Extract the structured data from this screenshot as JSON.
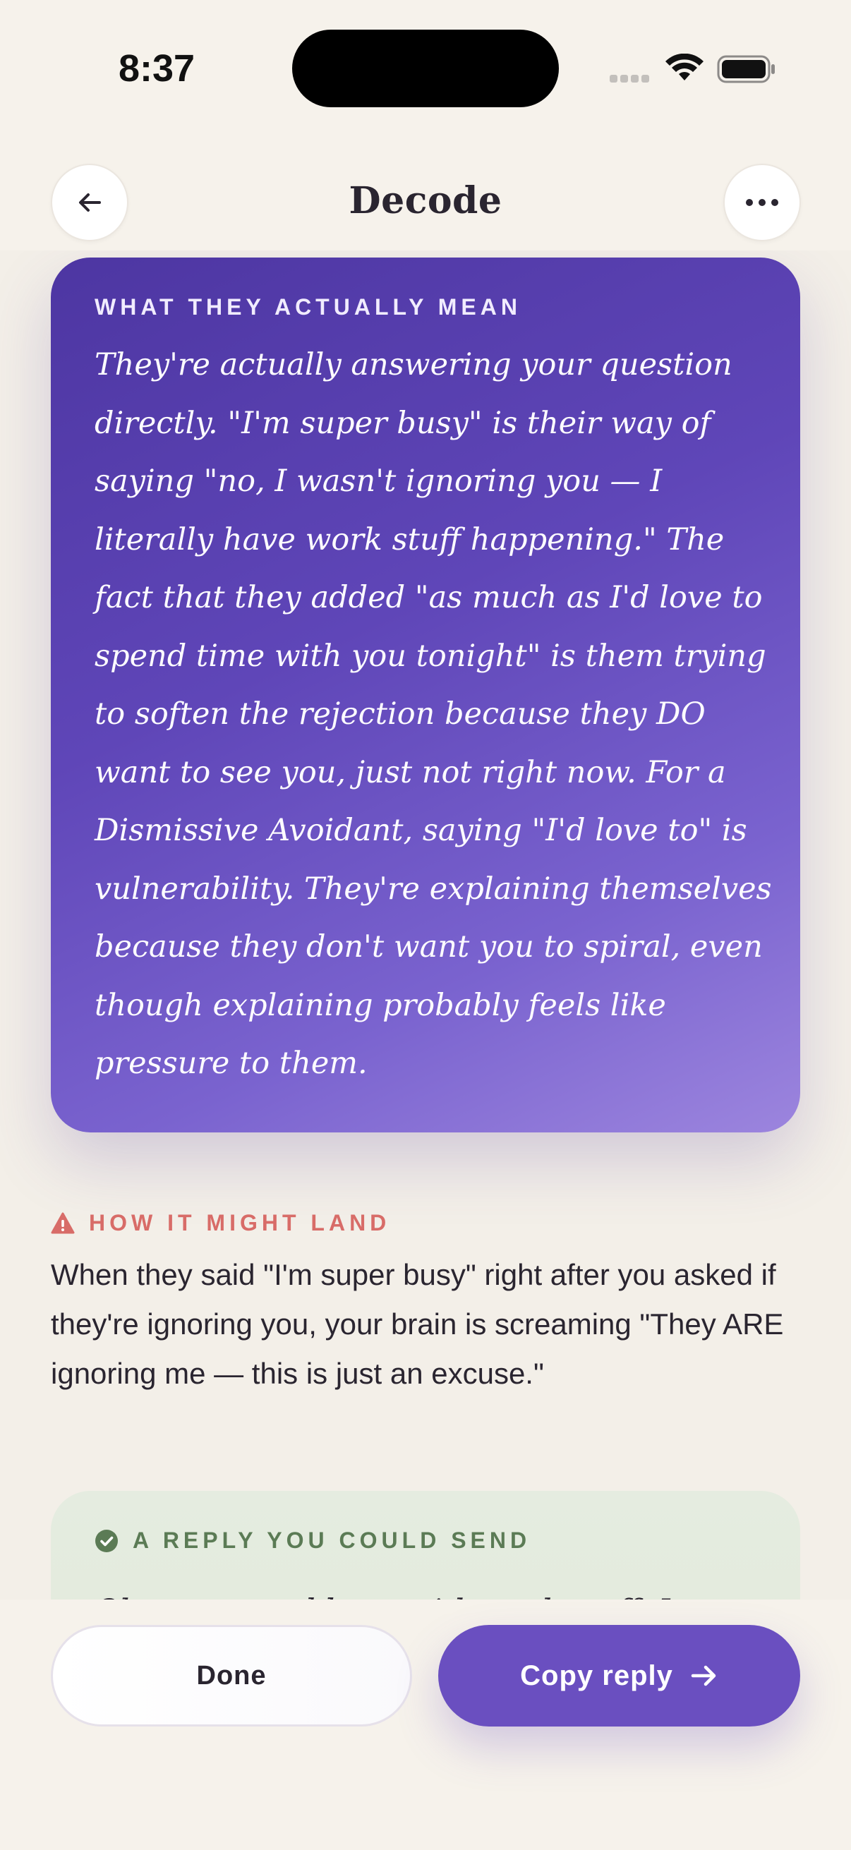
{
  "status_bar": {
    "time": "8:37"
  },
  "header": {
    "title": "Decode",
    "back_icon": "arrow-left-icon",
    "more_icon": "ellipsis-icon"
  },
  "meaning_card": {
    "eyebrow": "WHAT THEY ACTUALLY MEAN",
    "text": "They're actually answering your question directly. \"I'm super busy\" is their way of saying \"no, I wasn't ignoring you — I literally have work stuff happening.\" The fact that they added \"as much as I'd love to spend time with you tonight\" is them trying to soften the rejection because they DO want to see you, just not right now. For a Dismissive Avoidant, saying \"I'd love to\" is vulnerability. They're explaining themselves because they don't want you to spiral, even though explaining probably feels like pressure to them."
  },
  "landing": {
    "eyebrow": "HOW IT MIGHT LAND",
    "icon": "warning-icon",
    "text": "When they said \"I'm super busy\" right after you asked if they're ignoring you, your brain is screaming \"They ARE ignoring me — this is just an excuse.\""
  },
  "reply_card": {
    "eyebrow": "A REPLY YOU COULD SEND",
    "icon": "check-circle-icon",
    "text": "Oh, you sound busy with work stuff. Let me"
  },
  "actions": {
    "done_label": "Done",
    "copy_label": "Copy reply",
    "copy_icon": "arrow-right-icon"
  },
  "colors": {
    "background": "#f6f2eb",
    "accent": "#6a4fc0",
    "warning": "#d86c68",
    "success": "#5b7b55"
  }
}
